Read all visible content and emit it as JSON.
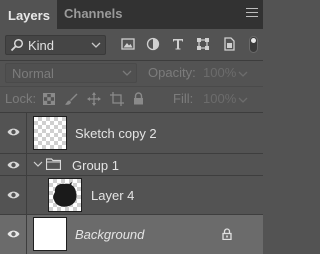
{
  "tabs": [
    {
      "label": "Layers",
      "active": true
    },
    {
      "label": "Channels",
      "active": false
    }
  ],
  "filter": {
    "kind_label": "Kind",
    "icons": [
      "image-filter-icon",
      "adjustment-filter-icon",
      "type-filter-icon",
      "shape-filter-icon",
      "smart-object-filter-icon"
    ]
  },
  "blend": {
    "mode": "Normal",
    "opacity_label": "Opacity:",
    "opacity_value": "100%"
  },
  "lock": {
    "label": "Lock:",
    "fill_label": "Fill:",
    "fill_value": "100%"
  },
  "layers": [
    {
      "name": "Sketch copy 2",
      "visible": true,
      "type": "pixel",
      "thumbnail": "transparent"
    },
    {
      "name": "Group 1",
      "visible": true,
      "type": "group",
      "expanded": true
    },
    {
      "name": "Layer 4",
      "visible": true,
      "type": "pixel",
      "thumbnail": "dark-blob",
      "indent": 1
    },
    {
      "name": "Background",
      "visible": true,
      "type": "background",
      "locked": true,
      "thumbnail": "white",
      "selected": true
    }
  ],
  "colors": {
    "panel": "#535353",
    "tabbar": "#323232",
    "selected_row": "#6b6b6b"
  }
}
